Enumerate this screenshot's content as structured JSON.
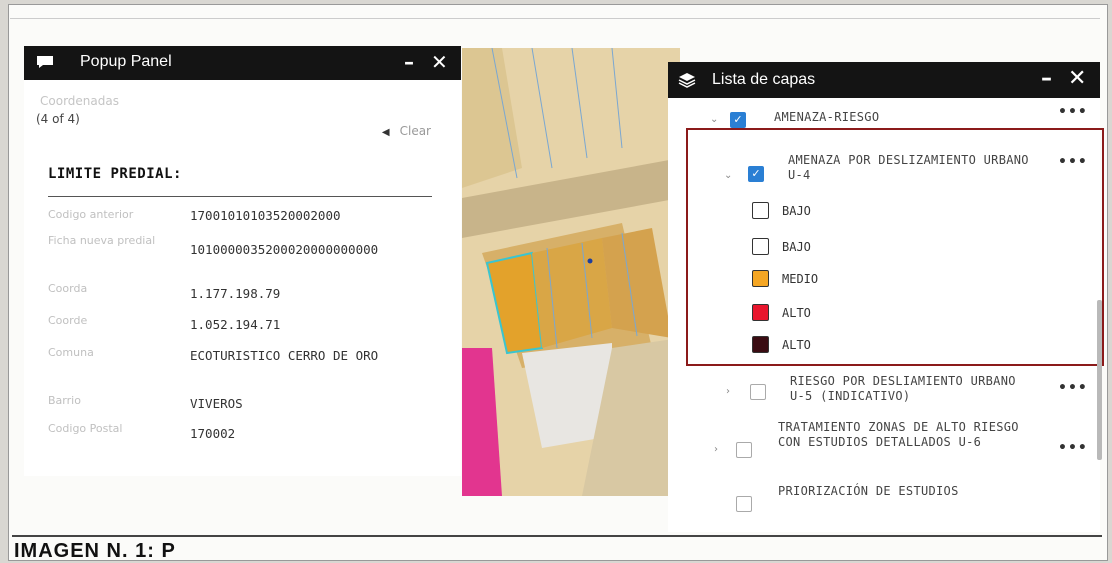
{
  "caption": "IMAGEN N. 1: P",
  "popup": {
    "title": "Popup Panel",
    "minimize": "–",
    "close": "✕",
    "faded_label": "Coordenadas",
    "count": "(4 of 4)",
    "clear_label": "Clear",
    "section_title": "LIMITE PREDIAL:",
    "attributes": [
      {
        "key": "Codigo anterior",
        "value": "17001010103520002000"
      },
      {
        "key": "Ficha nueva predial",
        "value": "1010000035200020000000000"
      },
      {
        "key": "Coorda",
        "value": "1.177.198.79"
      },
      {
        "key": "Coorde",
        "value": "1.052.194.71"
      },
      {
        "key": "Comuna",
        "value": "ECOTURISTICO CERRO DE ORO"
      },
      {
        "key": "Barrio",
        "value": "VIVEROS"
      },
      {
        "key": "Codigo Postal",
        "value": "170002"
      }
    ]
  },
  "layers": {
    "title": "Lista de capas",
    "minimize": "–",
    "close": "✕",
    "items": [
      {
        "label": "AMENAZA-RIESGO",
        "checked": true
      },
      {
        "label": "AMENAZA POR DESLIZAMIENTO URBANO U-4",
        "checked": true
      },
      {
        "label": "RIESGO POR DESLIAMIENTO URBANO U-5 (INDICATIVO)",
        "checked": false
      },
      {
        "label": "TRATAMIENTO ZONAS DE ALTO RIESGO CON ESTUDIOS DETALLADOS U-6",
        "checked": false
      },
      {
        "label": "PRIORIZACIÓN DE ESTUDIOS",
        "checked": false
      }
    ],
    "more": "•••",
    "legend": [
      {
        "label": "BAJO",
        "color": "#ffffff"
      },
      {
        "label": "BAJO",
        "color": "#ffffff"
      },
      {
        "label": "MEDIO",
        "color": "#f5a623"
      },
      {
        "label": "ALTO",
        "color": "#e8162d"
      },
      {
        "label": "ALTO",
        "color": "#3a0c12"
      }
    ]
  }
}
